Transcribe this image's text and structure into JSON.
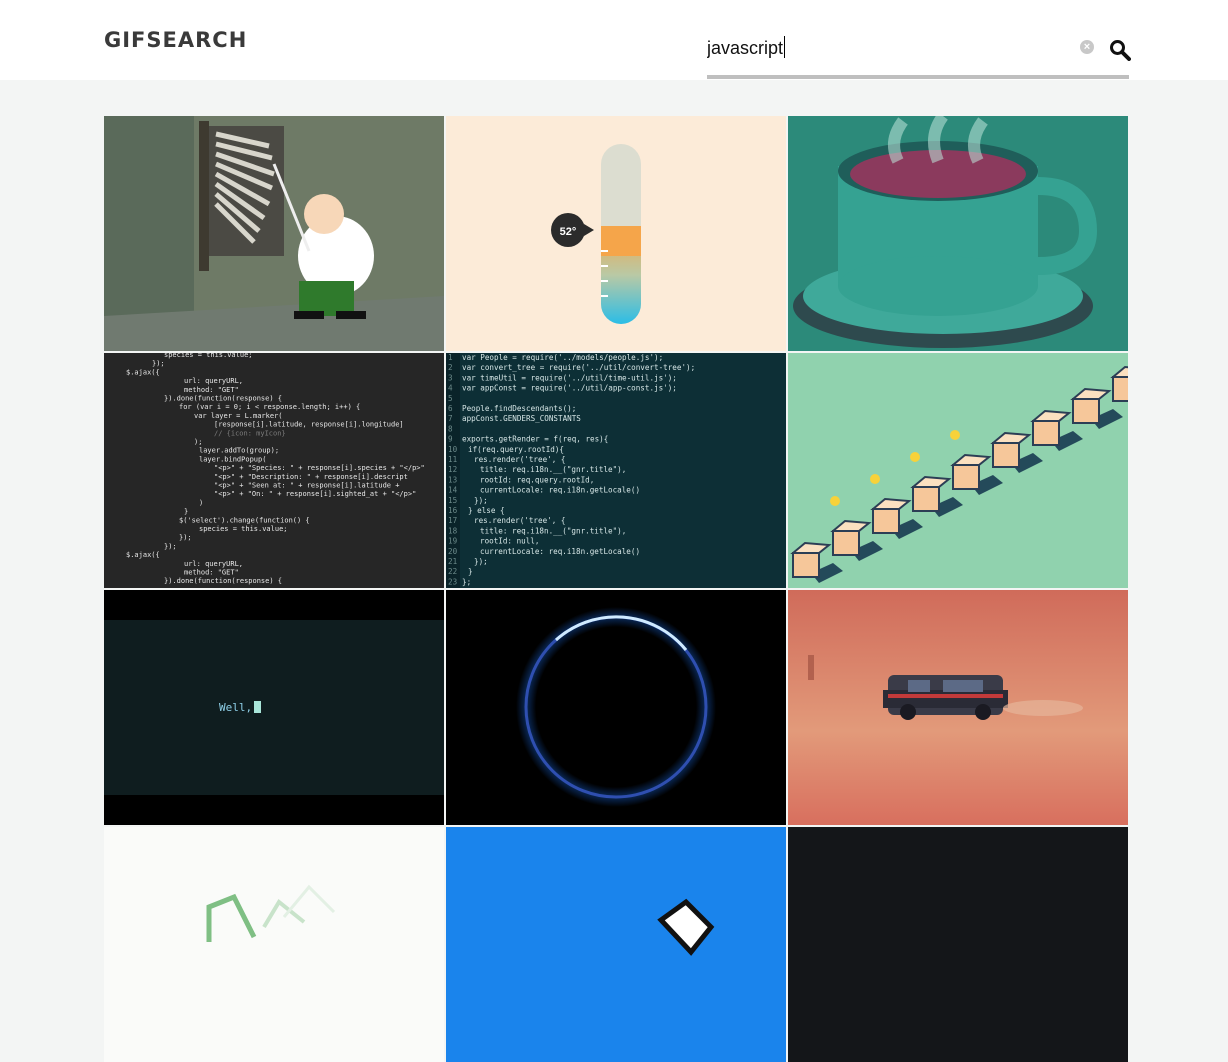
{
  "app": {
    "title": "GIFSEARCH"
  },
  "search": {
    "value": "javascript",
    "placeholder": ""
  },
  "icons": {
    "clear": "clear-circle-icon",
    "search": "magnifier-icon"
  },
  "colors": {
    "header_bg": "#ffffff",
    "page_bg": "#f3f5f4",
    "logo": "#3a3a3a",
    "underline": "#bfbfbf"
  },
  "gifs": [
    {
      "id": "gif-1",
      "caption_visible": "",
      "description_hidden": true
    },
    {
      "id": "gif-2",
      "thermometer_label": "52°"
    },
    {
      "id": "gif-3"
    },
    {
      "id": "gif-4"
    },
    {
      "id": "gif-5"
    },
    {
      "id": "gif-6"
    },
    {
      "id": "gif-7",
      "terminal_text": "Well,"
    },
    {
      "id": "gif-8"
    },
    {
      "id": "gif-9"
    },
    {
      "id": "gif-10"
    },
    {
      "id": "gif-11"
    },
    {
      "id": "gif-12"
    }
  ],
  "code_left": [
    "species = this.value;",
    "});",
    "$.ajax({",
    "url: queryURL,",
    "method: \"GET\"",
    "}).done(function(response) {",
    "for (var i = 0; i < response.length; i++) {",
    "var layer = L.marker(",
    "[response[i].latitude, response[i].longitude]",
    "// {icon: myIcon}",
    ");",
    "layer.addTo(group);",
    "layer.bindPopup(",
    "\"<p>\" + \"Species: \" + response[i].species + \"</p>\"",
    "\"<p>\" + \"Description: \" + response[i].descript",
    "\"<p>\" + \"Seen at: \" + response[i].latitude +",
    "\"<p>\" + \"On: \" + response[i].sighted_at + \"</p>\"",
    ")",
    "}",
    "$('select').change(function() {",
    "species = this.value;",
    "});",
    "});",
    "$.ajax({",
    "url: queryURL,",
    "method: \"GET\"",
    "}).done(function(response) {"
  ],
  "code_right": [
    "var People = require('../models/people.js');",
    "var convert_tree = require('../util/convert-tree');",
    "var timeUtil = require('../util/time-util.js');",
    "var appConst = require('../util/app-const.js');",
    "",
    "People.findDescendants();",
    "appConst.GENDERS_CONSTANTS",
    "",
    "exports.getRender = f(req, res){",
    "if(req.query.rootId){",
    "res.render('tree', {",
    "title: req.i18n.__(\"gnr.title\"),",
    "rootId: req.query.rootId,",
    "currentLocale: req.i18n.getLocale()",
    "});",
    "} else {",
    "res.render('tree', {",
    "title: req.i18n.__(\"gnr.title\"),",
    "rootId: null,",
    "currentLocale: req.i18n.getLocale()",
    "});",
    "}",
    "};"
  ]
}
